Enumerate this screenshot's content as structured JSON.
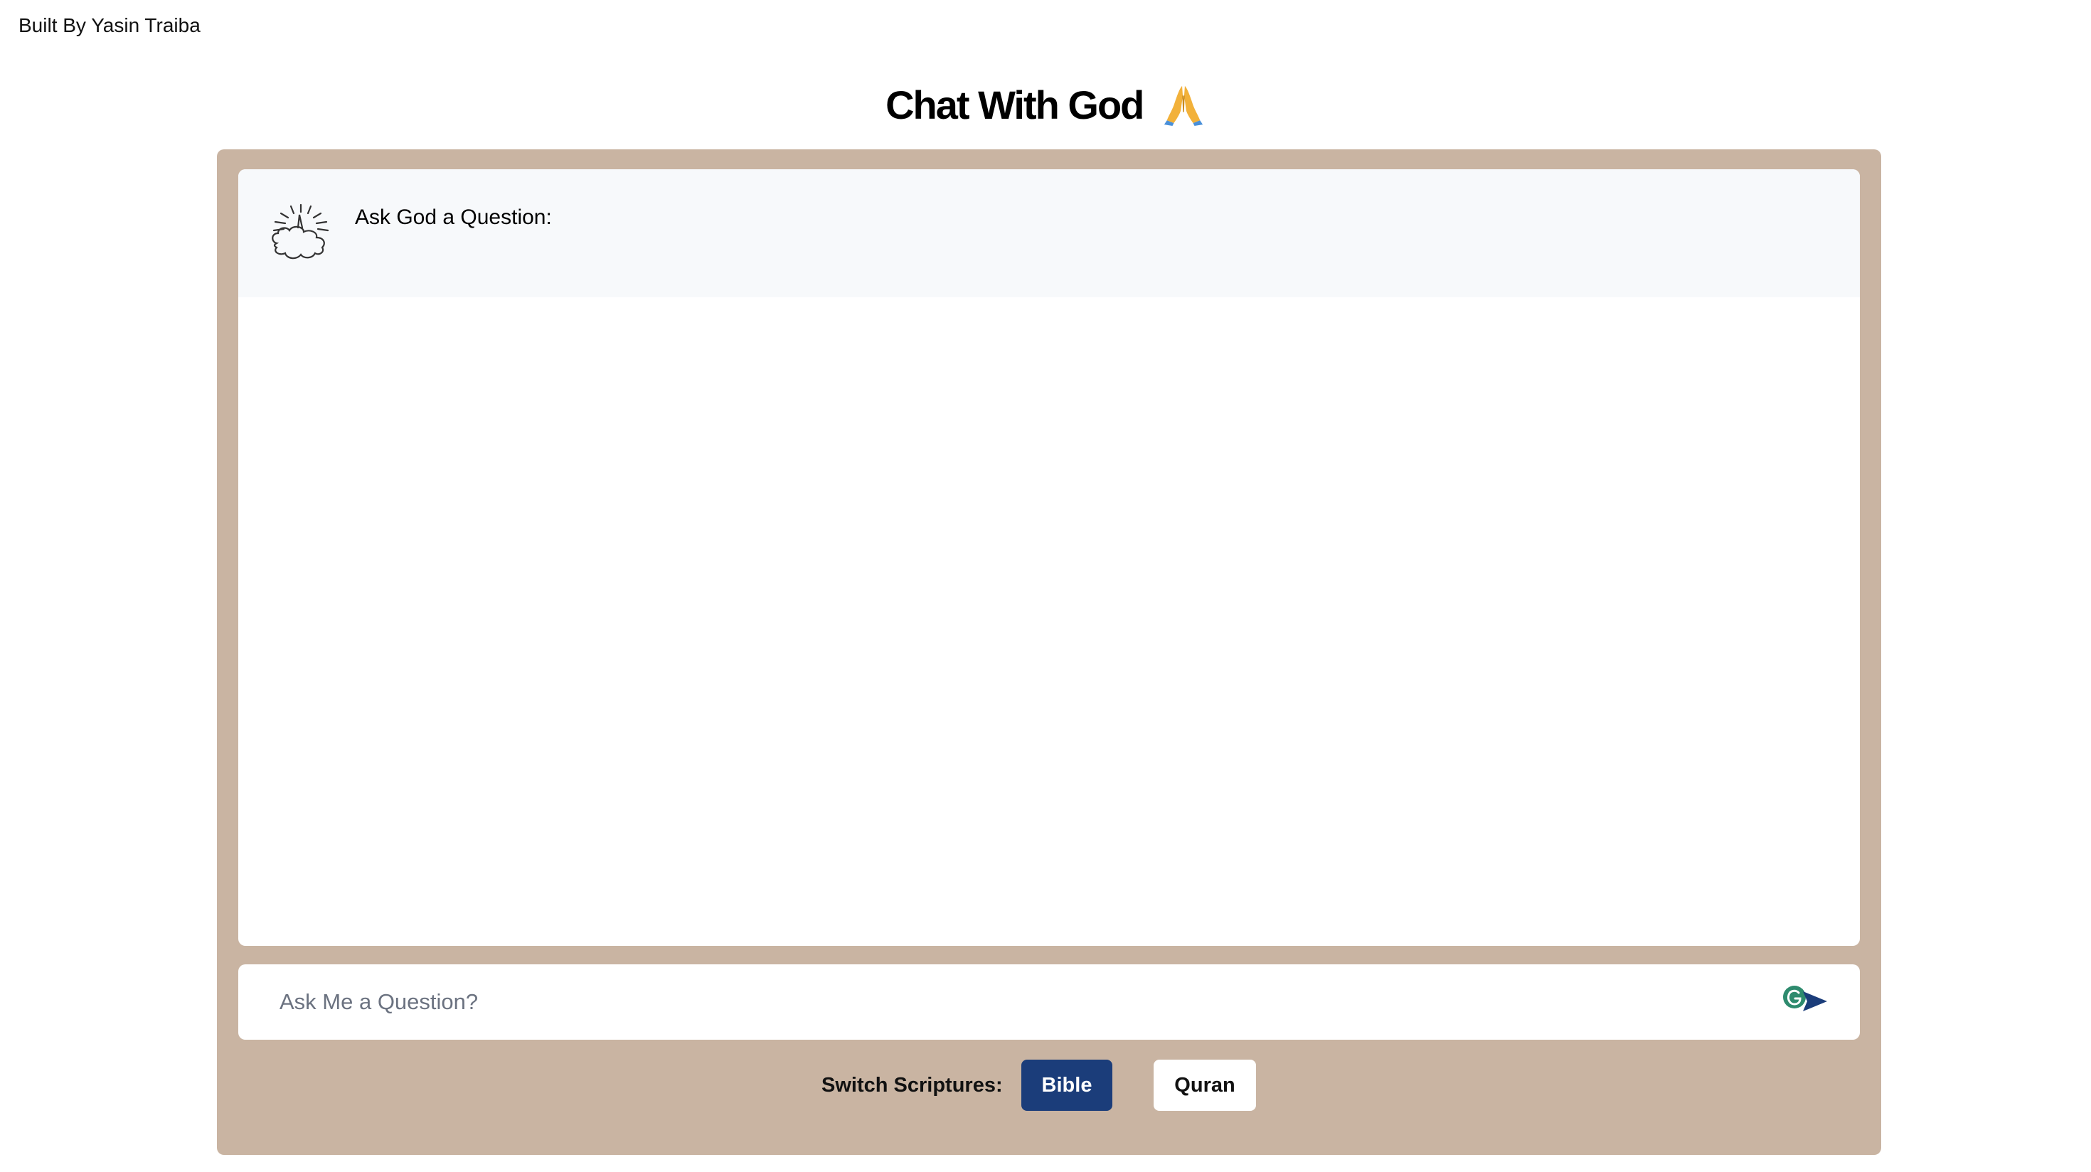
{
  "header": {
    "credit": "Built By Yasin Traiba",
    "title": "Chat With God",
    "title_icon": "praying-hands-icon"
  },
  "chat": {
    "messages": [
      {
        "sender_icon": "cloud-light-icon",
        "text": "Ask God a Question:"
      }
    ]
  },
  "input": {
    "placeholder": "Ask Me a Question?",
    "value": "",
    "send_icon": "send-arrow-icon",
    "extension_icon": "grammarly-icon"
  },
  "scriptures": {
    "label": "Switch Scriptures:",
    "options": [
      "Bible",
      "Quran"
    ],
    "selected": "Bible"
  },
  "colors": {
    "panel_bg": "#c9b4a2",
    "active_button": "#1b3d7a",
    "message_bg": "#f7f9fb",
    "grammarly": "#2e8b6e"
  }
}
